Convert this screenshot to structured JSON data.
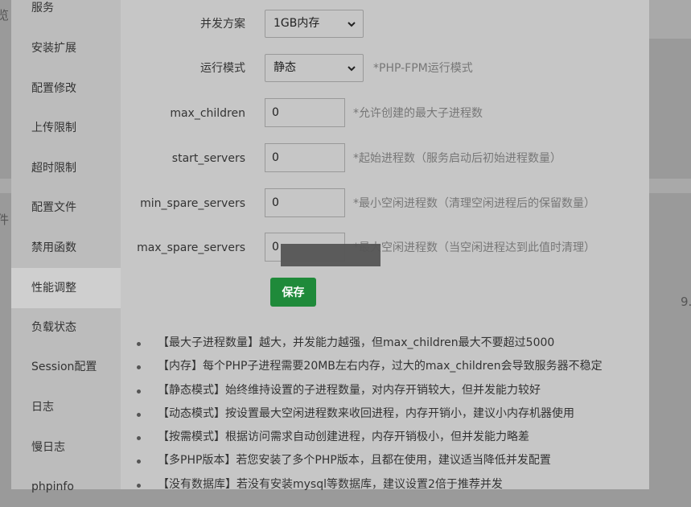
{
  "sidebar": {
    "items": [
      {
        "label": "服务",
        "active": false
      },
      {
        "label": "安装扩展",
        "active": false
      },
      {
        "label": "配置修改",
        "active": false
      },
      {
        "label": "上传限制",
        "active": false
      },
      {
        "label": "超时限制",
        "active": false
      },
      {
        "label": "配置文件",
        "active": false
      },
      {
        "label": "禁用函数",
        "active": false
      },
      {
        "label": "性能调整",
        "active": true
      },
      {
        "label": "负载状态",
        "active": false
      },
      {
        "label": "Session配置",
        "active": false
      },
      {
        "label": "日志",
        "active": false
      },
      {
        "label": "慢日志",
        "active": false
      },
      {
        "label": "phpinfo",
        "active": false
      }
    ]
  },
  "form": {
    "concurrency": {
      "label": "并发方案",
      "value": "1GB内存"
    },
    "run_mode": {
      "label": "运行模式",
      "value": "静态",
      "hint": "*PHP-FPM运行模式"
    },
    "max_children": {
      "label": "max_children",
      "value": "0",
      "hint": "*允许创建的最大子进程数"
    },
    "start_servers": {
      "label": "start_servers",
      "value": "0",
      "hint": "*起始进程数（服务启动后初始进程数量）"
    },
    "min_spare_servers": {
      "label": "min_spare_servers",
      "value": "0",
      "hint": "*最小空闲进程数（清理空闲进程后的保留数量）"
    },
    "max_spare_servers": {
      "label": "max_spare_servers",
      "value": "0",
      "hint": "*最大空闲进程数（当空闲进程达到此值时清理）"
    },
    "save_label": "保存"
  },
  "tips": [
    "【最大子进程数量】越大，并发能力越强，但max_children最大不要超过5000",
    "【内存】每个PHP子进程需要20MB左右内存，过大的max_children会导致服务器不稳定",
    "【静态模式】始终维持设置的子进程数量，对内存开销较大，但并发能力较好",
    "【动态模式】按设置最大空闲进程数来收回进程，内存开销小，建议小内存机器使用",
    "【按需模式】根据访问需求自动创建进程，内存开销极小，但并发能力略差",
    "【多PHP版本】若您安装了多个PHP版本，且都在使用，建议适当降低并发配置",
    "【没有数据库】若没有安装mysql等数据库，建议设置2倍于推荐并发"
  ],
  "background": {
    "left_fragment_1": "览",
    "left_fragment_2": "件",
    "right_fragment": "9."
  },
  "colors": {
    "overlay_bg": "#9a9a9a",
    "modal_bg": "#c6c6c6",
    "sidebar_bg": "#bcbcbc",
    "active_item_bg": "#cfcfcf",
    "save_button": "#1f8a3a"
  }
}
